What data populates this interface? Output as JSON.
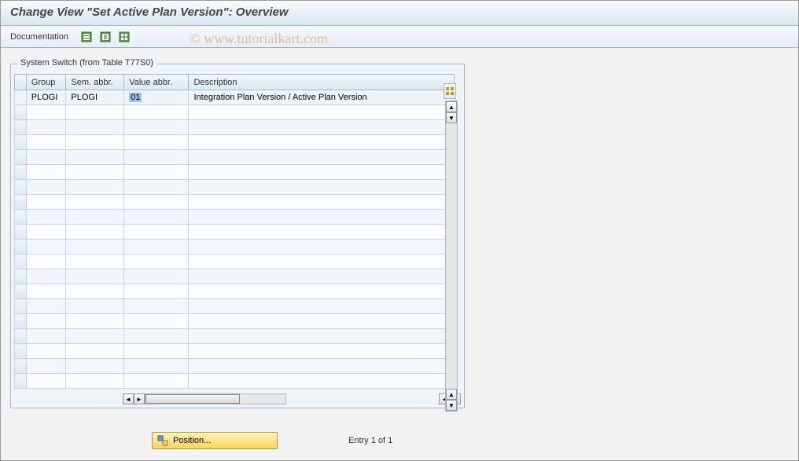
{
  "title": "Change View \"Set Active Plan Version\": Overview",
  "toolbar": {
    "documentation_label": "Documentation"
  },
  "panel": {
    "title": "System Switch (from Table T77S0)",
    "columns": {
      "group": "Group",
      "sem_abbr": "Sem. abbr.",
      "value_abbr": "Value abbr.",
      "description": "Description"
    },
    "rows": [
      {
        "group": "PLOGI",
        "sem_abbr": "PLOGI",
        "value_abbr": "01",
        "description": "Integration Plan Version / Active Plan Version"
      }
    ]
  },
  "footer": {
    "position_label": "Position...",
    "entry_text": "Entry 1 of 1"
  },
  "watermark": "© www.tutorialkart.com"
}
